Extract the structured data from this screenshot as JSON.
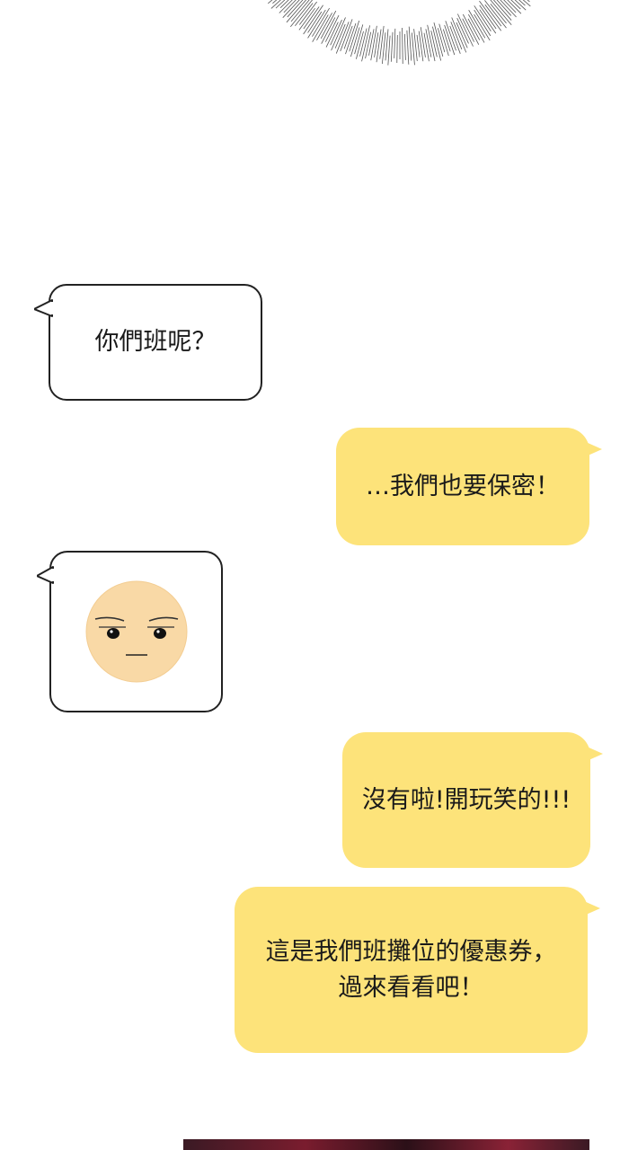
{
  "messages": [
    {
      "side": "left",
      "text": "你們班呢？"
    },
    {
      "side": "right",
      "text": "…我們也要保密！"
    },
    {
      "side": "left",
      "sticker": "smug-face-emoji"
    },
    {
      "side": "right",
      "text": "沒有啦!開玩笑的!!!"
    },
    {
      "side": "right",
      "lines": [
        "這是我們班攤位的優惠券，",
        "過來看看吧！"
      ]
    }
  ],
  "colors": {
    "right_bubble": "#fde37a",
    "left_bubble": "#ffffff",
    "bubble_border": "#222222",
    "face": "#f9d9a6"
  }
}
